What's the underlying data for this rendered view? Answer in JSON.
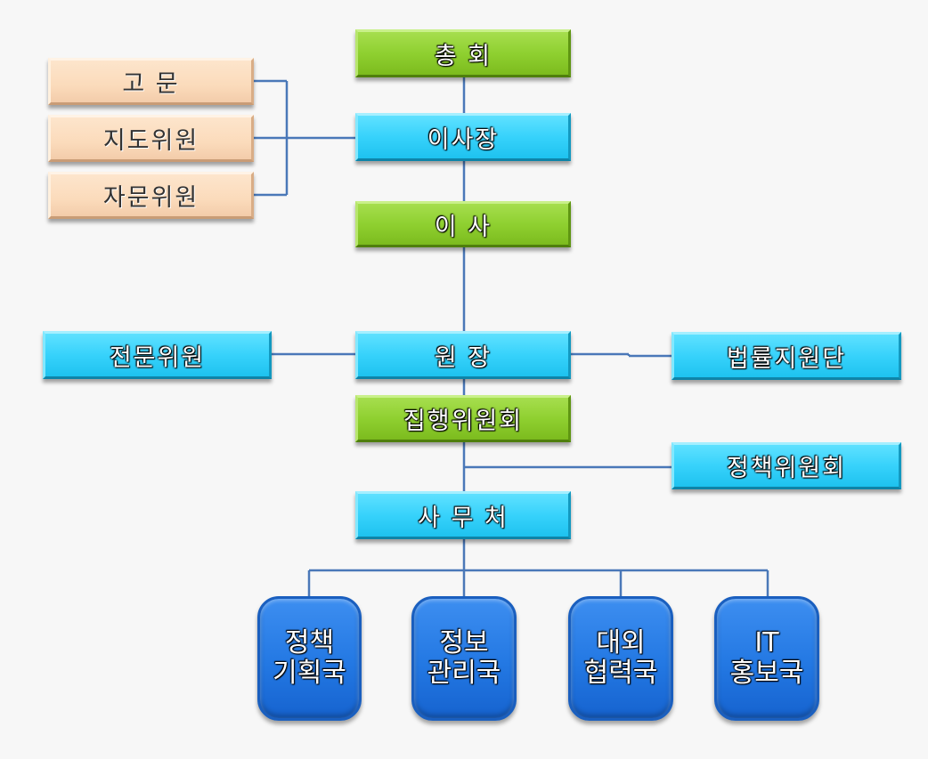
{
  "nodes": {
    "general_assembly": "총  회",
    "chairman": "이사장",
    "directors": "이  사",
    "advisor": "고  문",
    "guidance_committee": "지도위원",
    "consulting_committee": "자문위원",
    "specialist_committee": "전문위원",
    "director_general": "원  장",
    "legal_support_team": "법률지원단",
    "executive_committee": "집행위원회",
    "policy_committee": "정책위원회",
    "secretariat": "사 무 처"
  },
  "bureaus": [
    {
      "line1": "정책",
      "line2": "기획국"
    },
    {
      "line1": "정보",
      "line2": "관리국"
    },
    {
      "line1": "대외",
      "line2": "협력국"
    },
    {
      "line1": "IT",
      "line2": "홍보국"
    }
  ],
  "colors": {
    "connector": "#4a78b8",
    "green_box": "#8fd030",
    "cyan_box": "#37d2fb",
    "peach_box": "#fbdbbb",
    "blue_box": "#2378e3"
  }
}
